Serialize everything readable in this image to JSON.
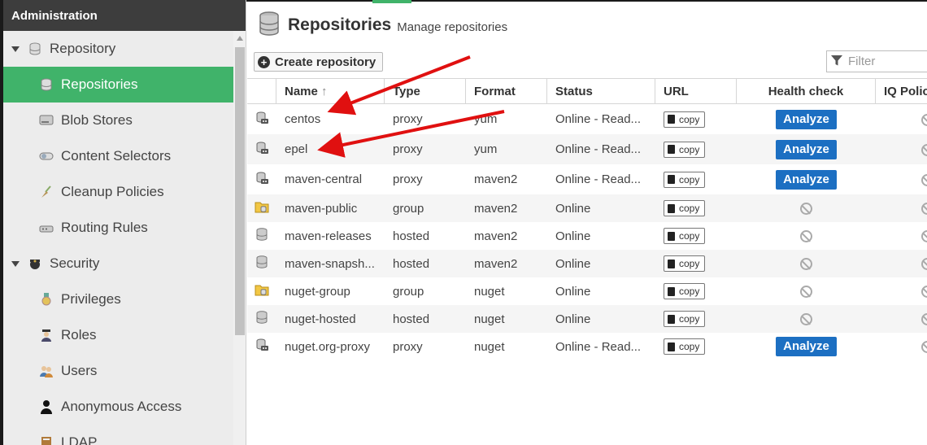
{
  "admin": {
    "title": "Administration",
    "nav": [
      {
        "label": "Repository",
        "kind": "group",
        "icon": "database-icon"
      },
      {
        "label": "Repositories",
        "kind": "child",
        "icon": "database-icon",
        "active": true
      },
      {
        "label": "Blob Stores",
        "kind": "child",
        "icon": "hard-drive-icon"
      },
      {
        "label": "Content Selectors",
        "kind": "child",
        "icon": "toggle-icon"
      },
      {
        "label": "Cleanup Policies",
        "kind": "child",
        "icon": "broom-icon"
      },
      {
        "label": "Routing Rules",
        "kind": "child",
        "icon": "router-icon"
      },
      {
        "label": "Security",
        "kind": "group",
        "icon": "police-badge-icon"
      },
      {
        "label": "Privileges",
        "kind": "child",
        "icon": "medal-icon"
      },
      {
        "label": "Roles",
        "kind": "child",
        "icon": "officer-icon"
      },
      {
        "label": "Users",
        "kind": "child",
        "icon": "users-icon"
      },
      {
        "label": "Anonymous Access",
        "kind": "child",
        "icon": "person-icon"
      },
      {
        "label": "LDAP",
        "kind": "child",
        "icon": "book-icon"
      }
    ]
  },
  "page": {
    "title": "Repositories",
    "subtitle": "Manage repositories",
    "create_label": "Create repository",
    "filter_placeholder": "Filter"
  },
  "table": {
    "columns": [
      "Name",
      "Type",
      "Format",
      "Status",
      "URL",
      "Health check",
      "IQ Policy"
    ],
    "sort_indicator": "↑",
    "copy_label": "copy",
    "analyze_label": "Analyze",
    "rows": [
      {
        "name": "centos",
        "type": "proxy",
        "format": "yum",
        "status": "Online - Read...",
        "icon": "proxy-repo-icon",
        "health": "analyze"
      },
      {
        "name": "epel",
        "type": "proxy",
        "format": "yum",
        "status": "Online - Read...",
        "icon": "proxy-repo-icon",
        "health": "analyze"
      },
      {
        "name": "maven-central",
        "type": "proxy",
        "format": "maven2",
        "status": "Online - Read...",
        "icon": "proxy-repo-icon",
        "health": "analyze"
      },
      {
        "name": "maven-public",
        "type": "group",
        "format": "maven2",
        "status": "Online",
        "icon": "group-repo-icon",
        "health": "disabled"
      },
      {
        "name": "maven-releases",
        "type": "hosted",
        "format": "maven2",
        "status": "Online",
        "icon": "hosted-repo-icon",
        "health": "disabled"
      },
      {
        "name": "maven-snapsh...",
        "type": "hosted",
        "format": "maven2",
        "status": "Online",
        "icon": "hosted-repo-icon",
        "health": "disabled"
      },
      {
        "name": "nuget-group",
        "type": "group",
        "format": "nuget",
        "status": "Online",
        "icon": "group-repo-icon",
        "health": "disabled"
      },
      {
        "name": "nuget-hosted",
        "type": "hosted",
        "format": "nuget",
        "status": "Online",
        "icon": "hosted-repo-icon",
        "health": "disabled"
      },
      {
        "name": "nuget.org-proxy",
        "type": "proxy",
        "format": "nuget",
        "status": "Online - Read...",
        "icon": "proxy-repo-icon",
        "health": "analyze"
      }
    ]
  },
  "colors": {
    "active_nav": "#40b36a",
    "analyze_button": "#1c6fc2",
    "annotation_arrow": "#e01010"
  }
}
